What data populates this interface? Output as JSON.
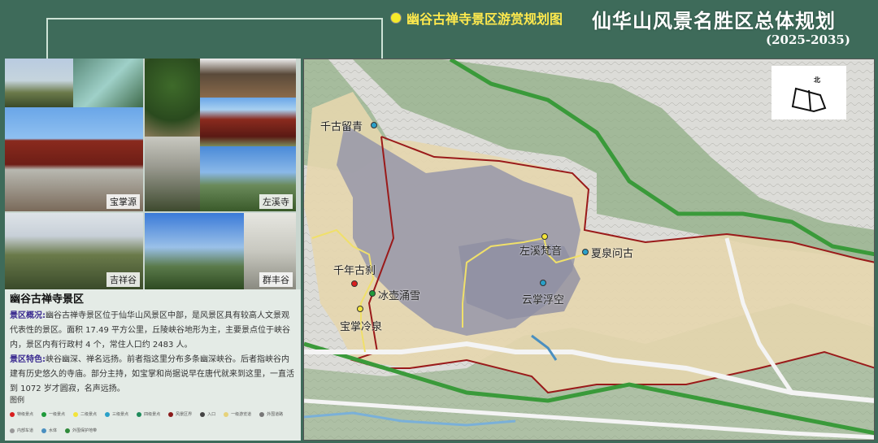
{
  "header": {
    "subtitle": "幽谷古禅寺景区游赏规划图",
    "title": "仙华山风景名胜区总体规划",
    "years": "(2025-2035)"
  },
  "photos": [
    {
      "caption": ""
    },
    {
      "caption": ""
    },
    {
      "caption": "宝掌源"
    },
    {
      "caption": ""
    },
    {
      "caption": ""
    },
    {
      "caption": ""
    },
    {
      "caption": "左溪寺"
    },
    {
      "caption": "吉祥谷"
    },
    {
      "caption": ""
    },
    {
      "caption": "群丰谷"
    }
  ],
  "info": {
    "heading": "幽谷古禅寺景区",
    "overview_label": "景区概况:",
    "overview_text": "幽谷古禅寺景区位于仙华山风景区中部，是风景区具有较高人文景观代表性的景区。面积 17.49 平方公里，丘陵峡谷地形为主，主要景点位于峡谷内，景区内有行政村 4 个，常住人口约 2483 人。",
    "feature_label": "景区特色:",
    "feature_text": "峡谷幽深、禅名远扬。前者指这里分布多条幽深峡谷。后者指峡谷内建有历史悠久的寺庙。部分主持，如宝掌和尚据说早在唐代就来到这里，一直活到 1072 岁才圆寂，名声远扬。",
    "legend_title": "图例"
  },
  "legend": [
    {
      "label": "特级景点",
      "color": "#d81e1e"
    },
    {
      "label": "一级景点",
      "color": "#1e9a3a"
    },
    {
      "label": "二级景点",
      "color": "#f3e43a"
    },
    {
      "label": "三级景点",
      "color": "#2aa0c8"
    },
    {
      "label": "四级景点",
      "color": "#1e8a5a"
    },
    {
      "label": "风景区界",
      "color": "#8a1a1a"
    },
    {
      "label": "入口",
      "color": "#444444"
    },
    {
      "label": "一级游览道",
      "color": "#e6d27a"
    },
    {
      "label": "外围道路",
      "color": "#777777"
    },
    {
      "label": "内部车道",
      "color": "#999999"
    },
    {
      "label": "水体",
      "color": "#4a8fc0"
    },
    {
      "label": "外围保护地带",
      "color": "#2f8a3a"
    }
  ],
  "map": {
    "compass_label": "北",
    "spots": [
      {
        "name": "千古留青",
        "color": "#2aa0c8"
      },
      {
        "name": "千年古刹",
        "color": "#d81e1e"
      },
      {
        "name": "冰壶涌雪",
        "color": "#1e9a3a"
      },
      {
        "name": "宝掌冷泉",
        "color": "#f3e43a"
      },
      {
        "name": "左溪梵音",
        "color": "#f3e43a"
      },
      {
        "name": "夏泉问古",
        "color": "#2aa0c8"
      },
      {
        "name": "云掌浮空",
        "color": "#2aa0c8"
      }
    ]
  }
}
